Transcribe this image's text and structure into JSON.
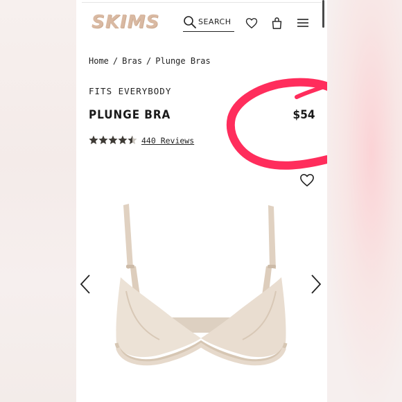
{
  "header": {
    "logo": "SKIMS",
    "search_label": "SEARCH"
  },
  "breadcrumb": [
    "Home",
    "Bras",
    "Plunge Bras"
  ],
  "product": {
    "collection": "FITS EVERYBODY",
    "title": "PLUNGE BRA",
    "price": "$54",
    "rating": 4.5,
    "reviews_label": "440 Reviews"
  },
  "colors": {
    "logo": "#d9b9a2",
    "annotation_circle": "#ff2d5c",
    "product_nude": "#e9ddd0"
  },
  "icons": [
    "search-icon",
    "heart-icon",
    "bag-icon",
    "menu-icon",
    "star-icon",
    "chevron-left-icon",
    "chevron-right-icon"
  ]
}
